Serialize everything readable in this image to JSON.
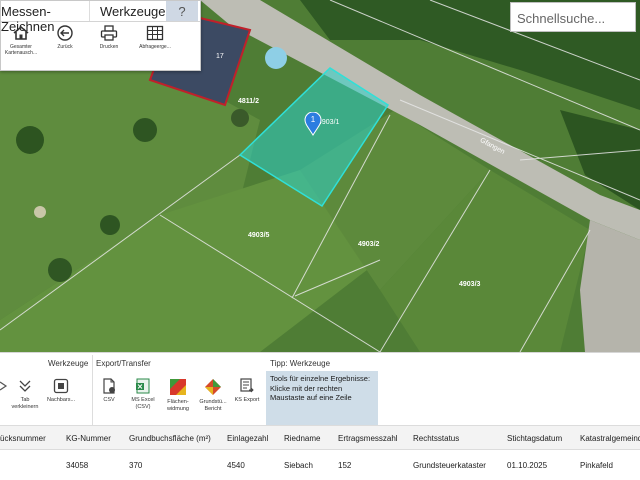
{
  "toolbar": {
    "tabs": [
      "Messen-Zeichnen",
      "Werkzeuge",
      "?"
    ],
    "buttons": [
      "Gesamter Kartenausch...",
      "Zurück",
      "Drucken",
      "Abfrageerge..."
    ]
  },
  "search": {
    "placeholder": "Schnellsuche..."
  },
  "map": {
    "labels": {
      "parcel_17": "17",
      "parcel_4811_2": "4811/2",
      "parcel_4903_1": "4903/1",
      "parcel_4903_5": "4903/5",
      "parcel_4903_2": "4903/2",
      "parcel_4903_3": "4903/3",
      "road": "Gfangen",
      "marker": "1"
    }
  },
  "ribbon": {
    "tabs": [
      "Werkzeuge",
      "Export/Transfer",
      "Tipp: Werkzeuge"
    ],
    "buttons": {
      "tab_verkleinern": "Tab verkleinern",
      "nachbars": "Nachbars...",
      "csv": "CSV",
      "ms_excel": "MS Excel (CSV)",
      "flaechenwidmung": "Flächen-widmung",
      "grundstueck_bericht": "Grundstü... Bericht",
      "ks_export": "KS Export"
    },
    "tip": "Tools für einzelne Ergebnisse: Klicke mit der rechten Maustaste auf eine Zeile"
  },
  "table": {
    "headers": [
      "ücksnummer",
      "KG-Nummer",
      "Grundbuchsfläche (m²)",
      "Einlagezahl",
      "Riedname",
      "Ertragsmesszahl",
      "Rechtsstatus",
      "Stichtagsdatum",
      "Katastralgemeinde"
    ],
    "row": [
      "",
      "34058",
      "370",
      "4540",
      "Siebach",
      "152",
      "Grundsteuerkataster",
      "01.10.2025",
      "Pinkafeld"
    ]
  }
}
